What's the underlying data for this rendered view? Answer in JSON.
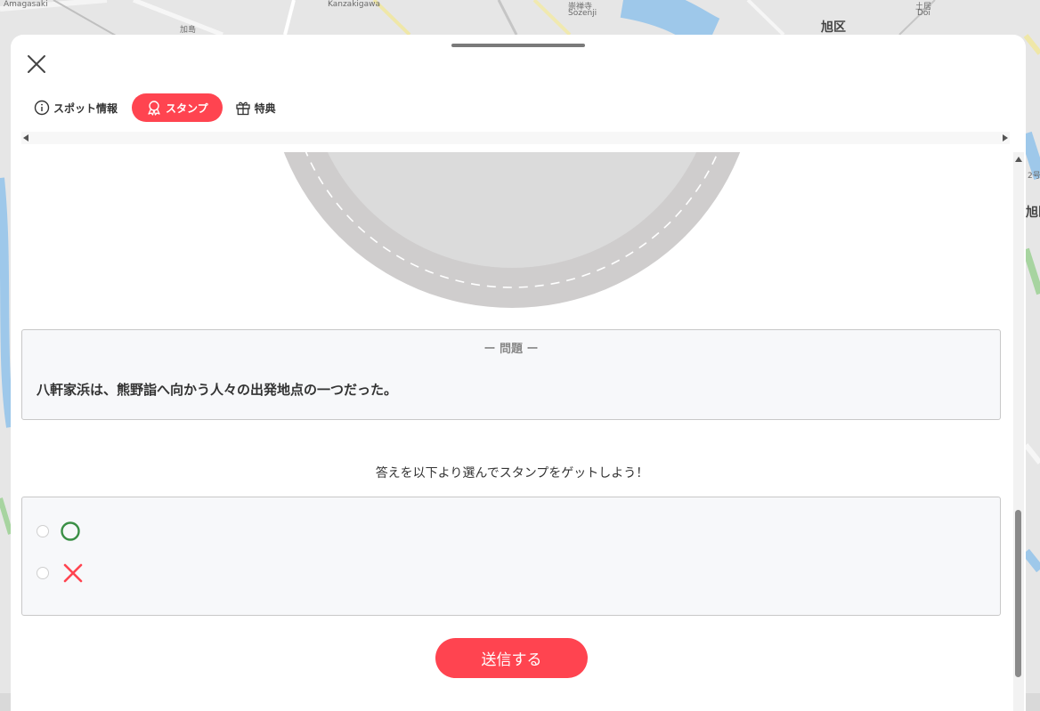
{
  "map": {
    "labels": [
      "Amagasaki",
      "加島",
      "Kanzakigawa",
      "崇禅寺",
      "Sozenji",
      "旭区",
      "土居",
      "Doi",
      "2号",
      "旭区"
    ]
  },
  "sheet": {
    "close_icon": "close-icon",
    "tabs": [
      {
        "label": "スポット情報",
        "icon": "info-icon",
        "active": false
      },
      {
        "label": "スタンプ",
        "icon": "stamp-ribbon-icon",
        "active": true
      },
      {
        "label": "特典",
        "icon": "gift-icon",
        "active": false
      }
    ]
  },
  "quiz": {
    "question_heading": "ー 問題 ー",
    "question_text": "八軒家浜は、熊野詣へ向かう人々の出発地点の一つだった。",
    "instruction": "答えを以下より選んでスタンプをゲットしよう！",
    "options": [
      {
        "icon": "circle-mark-icon",
        "color": "#3a8f45"
      },
      {
        "icon": "cross-mark-icon",
        "color": "#ff4450"
      }
    ],
    "submit_label": "送信する"
  },
  "colors": {
    "accent": "#ff4450",
    "correct": "#3a8f45",
    "stamp_ring": "#cfcfcf",
    "stamp_inner": "#dcdcdc"
  }
}
